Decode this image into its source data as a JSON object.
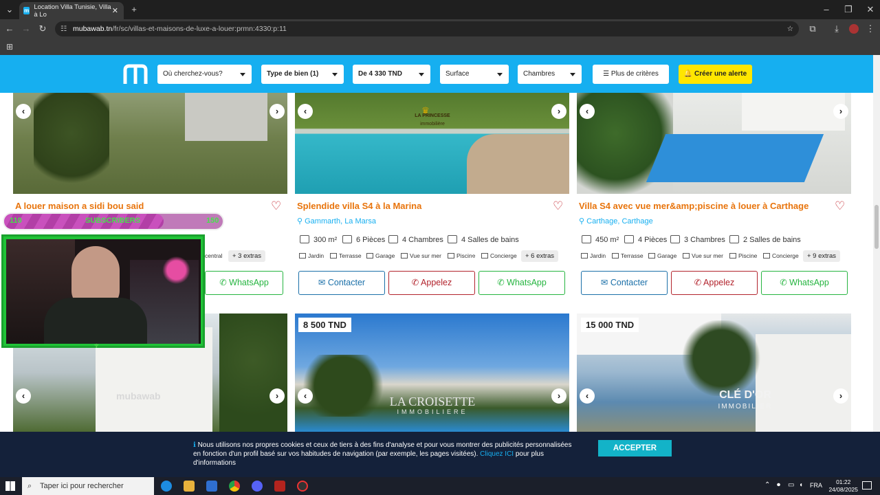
{
  "browser": {
    "tab_title": "Location Villa Tunisie, Villa à Lo",
    "url_domain": "mubawab.tn",
    "url_path": "/fr/sc/villas-et-maisons-de-luxe-a-louer:prmn:4330:p:11"
  },
  "filters": {
    "location_placeholder": "Où cherchez-vous?",
    "type": "Type de bien (1)",
    "price": "De 4 330 TND",
    "surface": "Surface",
    "rooms": "Chambres",
    "more": "Plus de critères",
    "alert": "Créer une alerte"
  },
  "listings": [
    {
      "title": "A louer maison a sidi bou said",
      "amenity_tail": "central",
      "extras": "+ 3 extras",
      "whatsapp": "WhatsApp"
    },
    {
      "title": "Splendide villa S4 à la Marina",
      "location": "Gammarth, La Marsa",
      "surface": "300 m²",
      "pieces": "6 Pièces",
      "chambres": "4 Chambres",
      "bains": "4 Salles de bains",
      "amenities": [
        "Jardin",
        "Terrasse",
        "Garage",
        "Vue sur mer",
        "Piscine",
        "Concierge"
      ],
      "extras": "+ 6 extras",
      "contact": "Contacter",
      "call": "Appelez",
      "whatsapp": "WhatsApp"
    },
    {
      "title": "Villa S4 avec vue mer&amp;piscine à louer à Carthage",
      "location": "Carthage, Carthage",
      "surface": "450 m²",
      "pieces": "4 Pièces",
      "chambres": "3 Chambres",
      "bains": "2 Salles de bains",
      "amenities": [
        "Jardin",
        "Terrasse",
        "Garage",
        "Vue sur mer",
        "Piscine",
        "Concierge"
      ],
      "extras": "+ 9 extras",
      "contact": "Contacter",
      "call": "Appelez",
      "whatsapp": "WhatsApp"
    }
  ],
  "row2_prices": [
    "8 500 TND",
    "15 000 TND"
  ],
  "watermarks": {
    "card2": "LA PRINCESSE",
    "card2_sub": "immobilière",
    "card4": "mubawab",
    "card5": "LA CROISETTE",
    "card5_sub": "IMMOBILIERE",
    "card6": "CLÉ D'OR",
    "card6_sub": "IMMOBILIER"
  },
  "overlay": {
    "sub_left": "110",
    "sub_mid": "SUBSCRIBERS",
    "sub_right": "150",
    "sub_progress_fraction": 0.73
  },
  "cookie": {
    "text": "Nous utilisons nos propres cookies et ceux de tiers à des fins d'analyse et pour vous montrer des publicités personnalisées en fonction d'un profil basé sur vos habitudes de navigation (par exemple, les pages visitées).",
    "link": "Cliquez ICI",
    "tail": "pour plus d'informations",
    "accept": "ACCEPTER"
  },
  "taskbar": {
    "search": "Taper ici pour rechercher",
    "lang": "FRA",
    "time": "01:22",
    "date": "24/08/2025"
  },
  "colors": {
    "brand_blue": "#16aff0",
    "title_orange": "#e8740c",
    "alert_yellow": "#ffe600",
    "whatsapp_green": "#25b43f",
    "call_red": "#b2222b"
  }
}
